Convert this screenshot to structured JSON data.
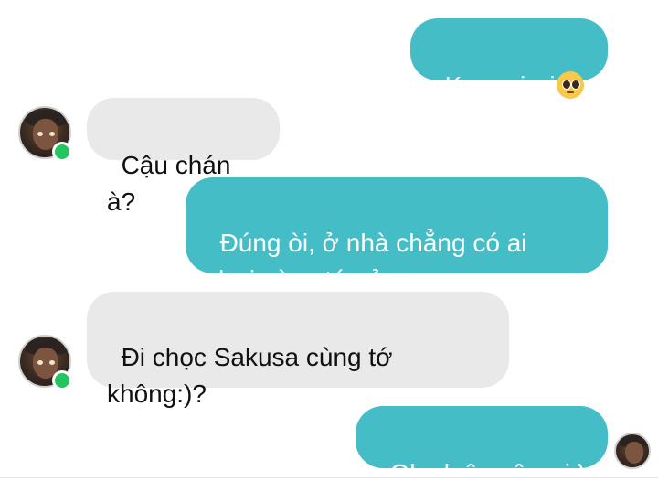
{
  "messages": [
    {
      "sender": "me",
      "text": "Komori ơi",
      "emoji": "pleading-face"
    },
    {
      "sender": "them",
      "text": "Cậu chán à?"
    },
    {
      "sender": "me",
      "text": "Đúng òi, ở nhà chẳng có ai\nchơi cùng tớ cả:<"
    },
    {
      "sender": "them",
      "text": "Đi chọc Sakusa cùng tớ\nkhông:)?"
    },
    {
      "sender": "me",
      "text": "Oke luôn cậu ơi:)"
    }
  ],
  "colors": {
    "outgoing_bubble": "#45bdc7",
    "incoming_bubble": "#e9e9e9",
    "online_indicator": "#22c55e"
  }
}
